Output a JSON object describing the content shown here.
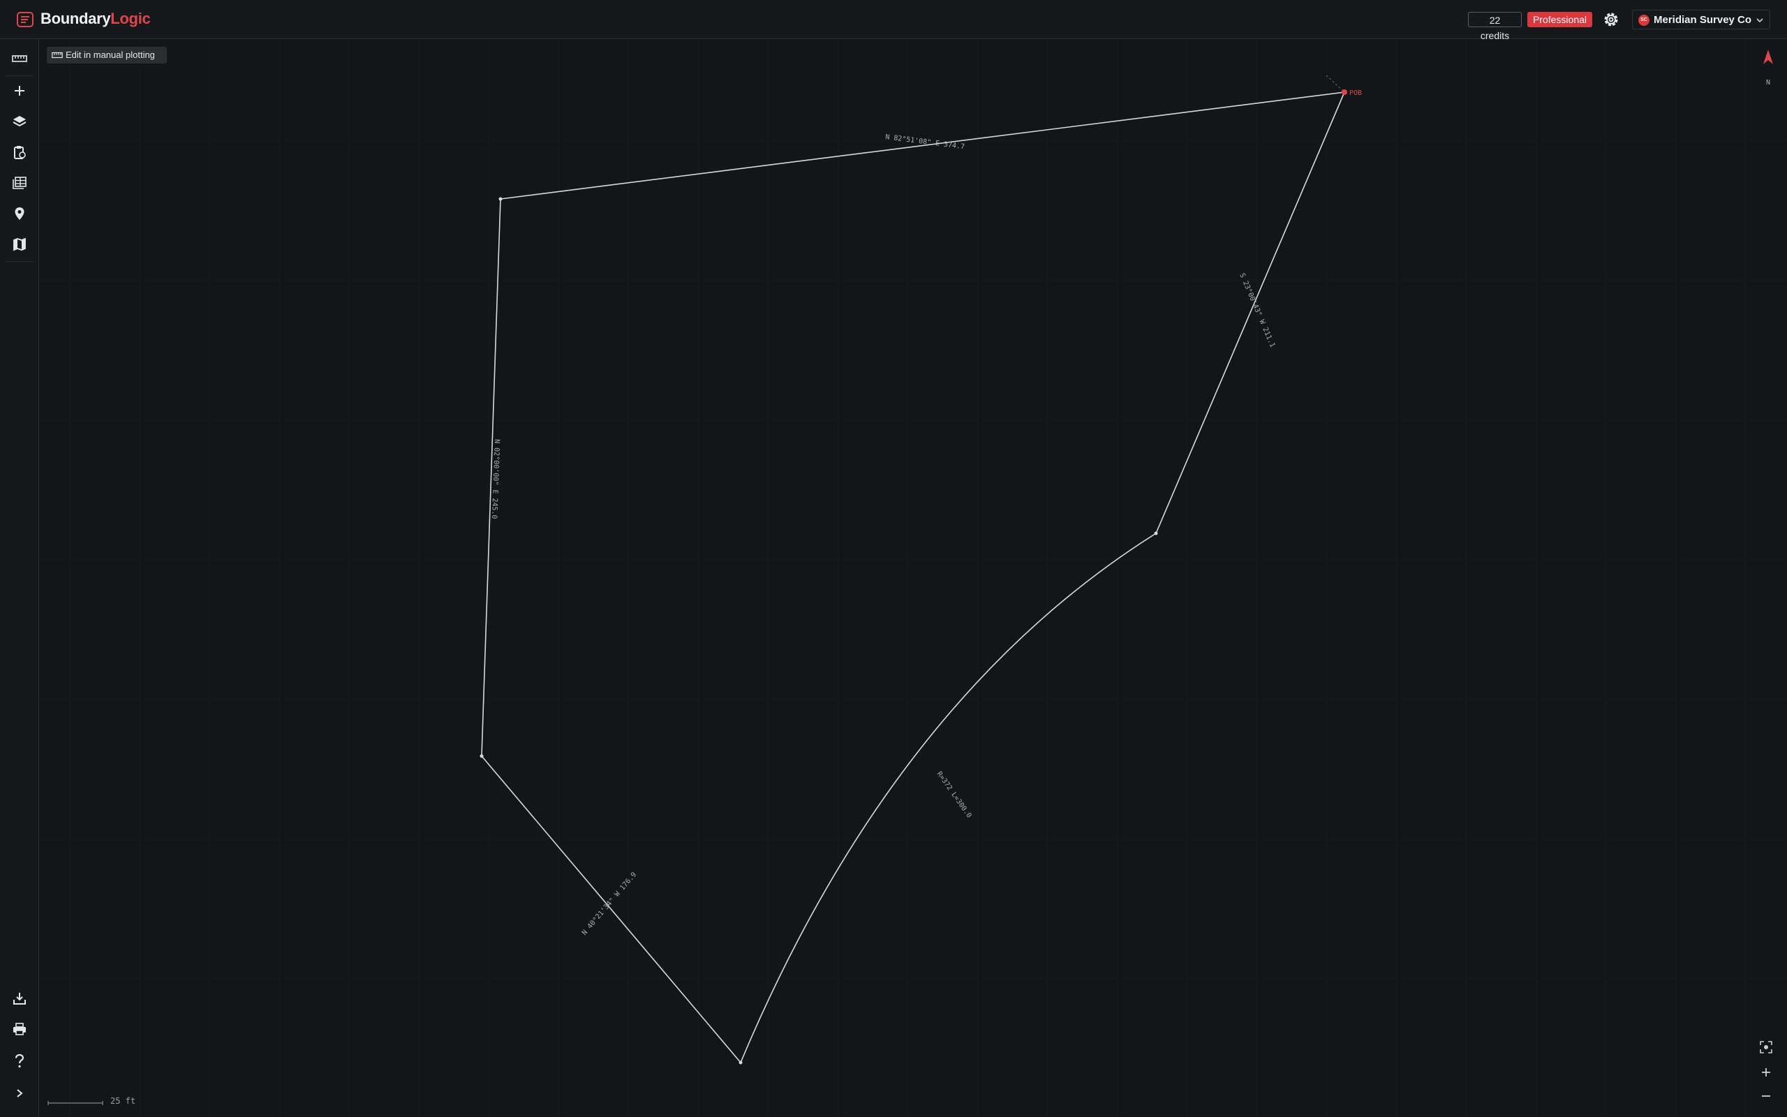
{
  "app": {
    "brand_part1": "Boundary",
    "brand_part2": "Logic",
    "brand_color": "#e0454b"
  },
  "header": {
    "credits": "22 credits",
    "plan": "Professional",
    "account": {
      "initials": "SC",
      "name": "Meridian Survey Co"
    }
  },
  "sidebar": {
    "top_items": [
      {
        "icon": "ruler-icon",
        "label": "Measure"
      },
      {
        "icon": "plus-icon",
        "label": "Add"
      },
      {
        "icon": "layers-icon",
        "label": "Layers"
      },
      {
        "icon": "clipboard-icon",
        "label": "Deed details"
      },
      {
        "icon": "table-icon",
        "label": "Calls table"
      },
      {
        "icon": "map-pin-icon",
        "label": "Location"
      },
      {
        "icon": "map-icon",
        "label": "Map"
      }
    ],
    "bottom_items": [
      {
        "icon": "download-icon"
      },
      {
        "icon": "print-icon"
      },
      {
        "icon": "help-icon"
      },
      {
        "icon": "chevron-right-icon"
      }
    ]
  },
  "toolbar": {
    "edit_label": "Edit in manual plotting"
  },
  "plot": {
    "pob_label": "POB",
    "line_color": "#d9d9d9",
    "pob_color": "#e0454b",
    "calls": [
      {
        "text": "N 82°51'08\" E 374.7"
      },
      {
        "text": "S 23°00'43\" W 211.1"
      },
      {
        "text": "R=372 L=300.0"
      },
      {
        "text": "N 40°21'34\" W 176.9"
      },
      {
        "text": "N 02°00'00\" E 245.0"
      }
    ]
  },
  "compass": {
    "north_label": "N"
  },
  "scale": {
    "label": "25 ft"
  }
}
